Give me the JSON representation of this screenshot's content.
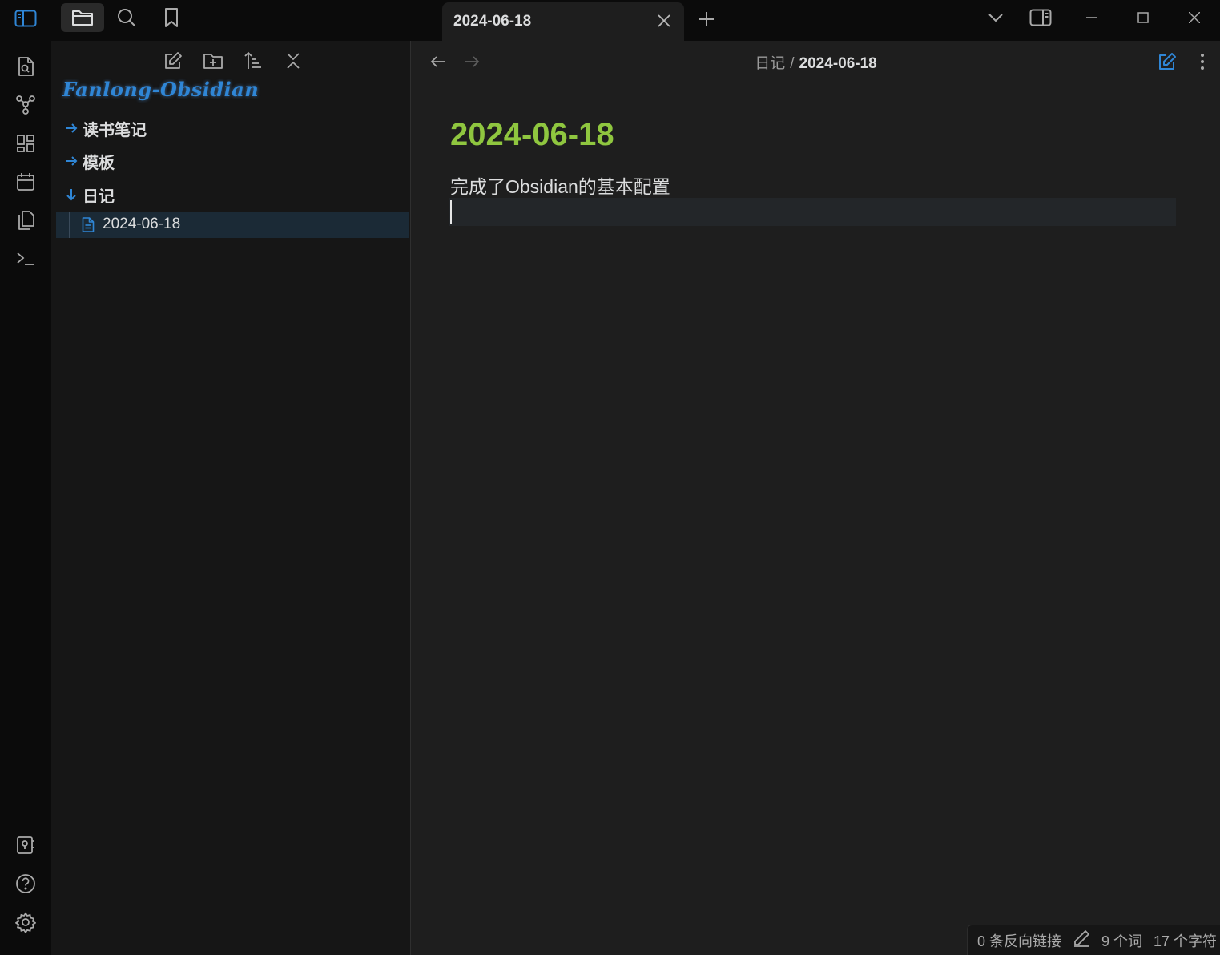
{
  "titlebar": {
    "tab_title": "2024-06-18"
  },
  "sidebar": {
    "vault_name": "Fanlong-Obsidian",
    "tree": [
      {
        "label": "读书笔记",
        "expanded": false
      },
      {
        "label": "模板",
        "expanded": false
      },
      {
        "label": "日记",
        "expanded": true
      }
    ],
    "active_file": "2024-06-18"
  },
  "editor": {
    "breadcrumb_folder": "日记",
    "breadcrumb_sep": "/",
    "breadcrumb_file": "2024-06-18",
    "title": "2024-06-18",
    "line1": "完成了Obsidian的基本配置"
  },
  "status": {
    "backlinks": "0 条反向链接",
    "words": "9 个词",
    "chars": "17 个字符"
  },
  "colors": {
    "accent": "#2f86d6",
    "title_green": "#8fc63f",
    "background": "#1e1e1e",
    "sidebar": "#161616"
  }
}
